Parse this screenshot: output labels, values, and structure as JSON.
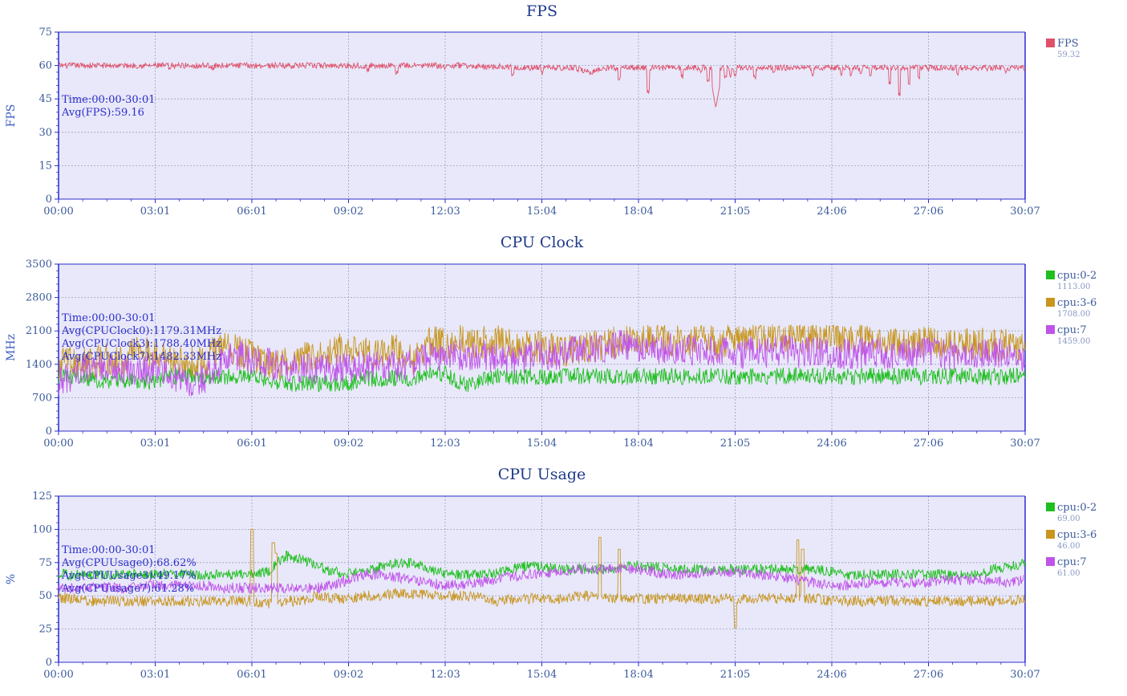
{
  "chart_data": [
    {
      "type": "line",
      "title": "FPS",
      "ylabel": "FPS",
      "ylim": [
        0,
        75
      ],
      "yticks": [
        "0",
        "15",
        "30",
        "45",
        "60",
        "75"
      ],
      "xlabels": [
        "00:00",
        "03:01",
        "06:01",
        "09:02",
        "12:03",
        "15:04",
        "18:04",
        "21:05",
        "24:06",
        "27:06",
        "30:07"
      ],
      "annotations": [
        "Time:00:00-30:01",
        "Avg(FPS):59.16"
      ],
      "grid": true,
      "legend_position": "right",
      "series": [
        {
          "name": "FPS",
          "legend_value": "59.32",
          "color": "#e0506a",
          "base": [
            60,
            60,
            60,
            60,
            60,
            60,
            60,
            60,
            60,
            60,
            60,
            60,
            60,
            60,
            60,
            60,
            60,
            60,
            60,
            60,
            60,
            60,
            60,
            60,
            60,
            60,
            59.5,
            59.5,
            59.5,
            59,
            59,
            59,
            59,
            57,
            59,
            59,
            59,
            59,
            59,
            59,
            59,
            59,
            59,
            59,
            59,
            59,
            59,
            59,
            59,
            59,
            59,
            59,
            59,
            59,
            59,
            59,
            59,
            59,
            59,
            59,
            59
          ],
          "dips": [
            [
              0.115,
              57
            ],
            [
              0.16,
              57
            ],
            [
              0.32,
              57
            ],
            [
              0.35,
              56
            ],
            [
              0.4,
              58
            ],
            [
              0.47,
              55
            ],
            [
              0.5,
              56
            ],
            [
              0.58,
              53
            ],
            [
              0.61,
              47
            ],
            [
              0.645,
              54
            ],
            [
              0.665,
              56
            ],
            [
              0.672,
              52
            ],
            [
              0.682,
              50
            ],
            [
              0.69,
              54
            ],
            [
              0.695,
              54
            ],
            [
              0.7,
              55
            ],
            [
              0.72,
              54
            ],
            [
              0.74,
              56
            ],
            [
              0.76,
              58
            ],
            [
              0.78,
              55
            ],
            [
              0.81,
              55
            ],
            [
              0.82,
              55
            ],
            [
              0.83,
              55
            ],
            [
              0.84,
              55
            ],
            [
              0.86,
              51
            ],
            [
              0.87,
              46
            ],
            [
              0.88,
              51
            ],
            [
              0.89,
              54
            ],
            [
              0.9,
              57
            ],
            [
              0.93,
              55
            ],
            [
              0.96,
              57
            ],
            [
              0.98,
              56
            ]
          ],
          "deep_dip": [
            0.68,
            41
          ],
          "noise": 1.3
        }
      ]
    },
    {
      "type": "line",
      "title": "CPU Clock",
      "ylabel": "MHz",
      "ylim": [
        0,
        3500
      ],
      "yticks": [
        "0",
        "700",
        "1400",
        "2100",
        "2800",
        "3500"
      ],
      "xlabels": [
        "00:00",
        "03:01",
        "06:01",
        "09:02",
        "12:03",
        "15:04",
        "18:04",
        "21:05",
        "24:06",
        "27:06",
        "30:07"
      ],
      "annotations": [
        "Time:00:00-30:01",
        "Avg(CPUClock0):1179.31MHz",
        "Avg(CPUClock3):1788.40MHz",
        "Avg(CPUClock7):1482.33MHz"
      ],
      "grid": true,
      "legend_position": "right",
      "series": [
        {
          "name": "cpu:0-2",
          "legend_value": "1113.00",
          "color": "#1fbf1f",
          "base": [
            1150,
            1150,
            1100,
            1050,
            1050,
            1050,
            1050,
            1150,
            1200,
            1150,
            1150,
            1150,
            1150,
            1100,
            1000,
            1000,
            1000,
            1000,
            1000,
            1100,
            1100,
            1100,
            1100,
            1200,
            1200,
            1000,
            1000,
            1150,
            1150,
            1150,
            1150,
            1150,
            1150,
            1150,
            1150,
            1150,
            1150,
            1150,
            1150,
            1150,
            1150,
            1150,
            1150,
            1150,
            1150,
            1150,
            1150,
            1150,
            1150,
            1150,
            1150,
            1150,
            1150,
            1150,
            1150,
            1150,
            1150,
            1150,
            1150,
            1150,
            1150
          ],
          "noise": 180,
          "cap": 1380
        },
        {
          "name": "cpu:3-6",
          "legend_value": "1708.00",
          "color": "#c8961e",
          "base": [
            1400,
            1500,
            1450,
            1500,
            1450,
            1700,
            1600,
            1550,
            1500,
            1400,
            1800,
            1700,
            1550,
            1400,
            1400,
            1500,
            1600,
            1700,
            1750,
            1650,
            1600,
            1750,
            1500,
            1900,
            1800,
            1900,
            1800,
            1950,
            1800,
            1750,
            1750,
            1700,
            1700,
            1750,
            1800,
            1900,
            1800,
            2000,
            1900,
            1900,
            2000,
            1800,
            2000,
            2000,
            2000,
            2000,
            2000,
            2000,
            2000,
            1900,
            1950,
            1850,
            1850,
            1850,
            1900,
            1850,
            1800,
            1850,
            1800,
            1800,
            1800
          ],
          "noise": 350,
          "cap": 2180
        },
        {
          "name": "cpu:7",
          "legend_value": "1459.00",
          "color": "#bf55e8",
          "base": [
            1000,
            1200,
            1350,
            1250,
            1300,
            1250,
            1350,
            1200,
            1000,
            1100,
            1400,
            1600,
            1500,
            1450,
            1300,
            1300,
            1300,
            1350,
            1350,
            1350,
            1400,
            1350,
            1400,
            1550,
            1550,
            1600,
            1600,
            1550,
            1500,
            1550,
            1600,
            1600,
            1700,
            1700,
            1750,
            1800,
            1750,
            1700,
            1750,
            1700,
            1700,
            1650,
            1600,
            1650,
            1650,
            1700,
            1650,
            1700,
            1650,
            1600,
            1650,
            1650,
            1600,
            1650,
            1650,
            1600,
            1600,
            1600,
            1650,
            1600,
            1500
          ],
          "noise": 330,
          "cap": 2300
        }
      ]
    },
    {
      "type": "line",
      "title": "CPU Usage",
      "ylabel": "%",
      "ylim": [
        0,
        125
      ],
      "yticks": [
        "0",
        "25",
        "50",
        "75",
        "100",
        "125"
      ],
      "xlabels": [
        "00:00",
        "03:01",
        "06:01",
        "09:02",
        "12:03",
        "15:04",
        "18:04",
        "21:05",
        "24:06",
        "27:06",
        "30:07"
      ],
      "annotations": [
        "Time:00:00-30:01",
        "Avg(CPUUsage0):68.62%",
        "Avg(CPUUsage3):49.17%",
        "Avg(CPUusage7):61.28%"
      ],
      "grid": true,
      "legend_position": "right",
      "series": [
        {
          "name": "cpu:0-2",
          "legend_value": "69.00",
          "color": "#1fbf1f",
          "base": [
            66,
            66,
            66,
            66,
            66,
            66,
            66,
            66,
            66,
            66,
            66,
            66,
            66,
            68,
            80,
            78,
            73,
            68,
            67,
            67,
            72,
            75,
            75,
            70,
            66,
            66,
            66,
            66,
            70,
            72,
            72,
            70,
            70,
            70,
            70,
            72,
            72,
            72,
            70,
            70,
            70,
            70,
            70,
            70,
            70,
            70,
            70,
            70,
            68,
            66,
            66,
            66,
            66,
            66,
            66,
            66,
            66,
            66,
            70,
            72,
            74
          ],
          "noise": 4
        },
        {
          "name": "cpu:3-6",
          "legend_value": "46.00",
          "color": "#c8961e",
          "base": [
            48,
            48,
            46,
            46,
            46,
            46,
            45,
            46,
            46,
            46,
            46,
            46,
            46,
            44,
            46,
            46,
            50,
            48,
            48,
            50,
            50,
            52,
            52,
            50,
            50,
            50,
            50,
            46,
            47,
            48,
            48,
            48,
            50,
            50,
            48,
            48,
            48,
            48,
            48,
            48,
            48,
            48,
            48,
            48,
            48,
            48,
            48,
            48,
            46,
            46,
            46,
            46,
            46,
            46,
            46,
            46,
            46,
            46,
            46,
            46,
            48
          ],
          "noise": 4,
          "spikes": [
            [
              0.2,
              100
            ],
            [
              0.222,
              90
            ],
            [
              0.225,
              82
            ],
            [
              0.56,
              94
            ],
            [
              0.58,
              85
            ],
            [
              0.765,
              92
            ],
            [
              0.77,
              85
            ],
            [
              0.7,
              26
            ]
          ]
        },
        {
          "name": "cpu:7",
          "legend_value": "61.00",
          "color": "#bf55e8",
          "base": [
            56,
            56,
            56,
            56,
            56,
            56,
            58,
            58,
            58,
            58,
            56,
            56,
            56,
            56,
            56,
            56,
            56,
            58,
            62,
            66,
            66,
            64,
            62,
            60,
            58,
            58,
            60,
            62,
            64,
            66,
            66,
            68,
            70,
            70,
            70,
            70,
            70,
            68,
            66,
            66,
            68,
            68,
            68,
            66,
            66,
            64,
            62,
            60,
            58,
            58,
            60,
            60,
            60,
            60,
            60,
            62,
            62,
            62,
            62,
            60,
            62
          ],
          "noise": 4
        }
      ]
    }
  ]
}
